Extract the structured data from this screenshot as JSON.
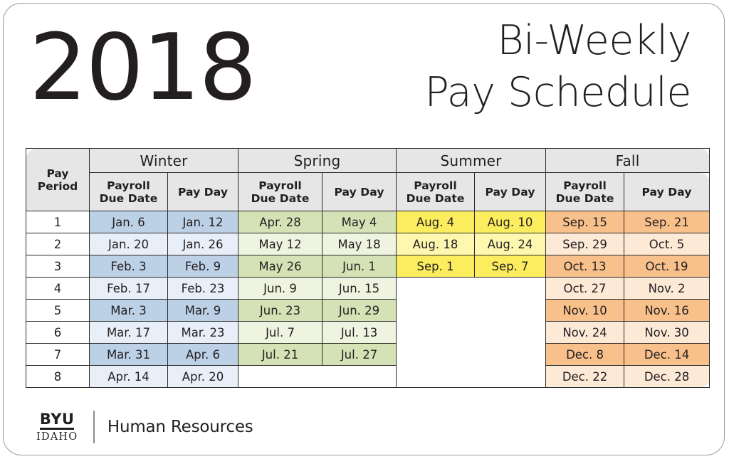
{
  "document": {
    "year": "2018",
    "headline_line1": "Bi-Weekly",
    "headline_line2": "Pay Schedule"
  },
  "table": {
    "pay_period_header": "Pay\nPeriod",
    "pay_period_header_line1": "Pay",
    "pay_period_header_line2": "Period",
    "seasons": [
      "Winter",
      "Spring",
      "Summer",
      "Fall"
    ],
    "sub_headers": [
      "Payroll Due Date",
      "Pay Day"
    ],
    "sub_header_due_line1": "Payroll",
    "sub_header_due_line2": "Due Date",
    "sub_header_payday": "Pay Day",
    "pay_periods": [
      "1",
      "2",
      "3",
      "4",
      "5",
      "6",
      "7",
      "8"
    ],
    "winter": {
      "due": [
        "Jan. 6",
        "Jan. 20",
        "Feb. 3",
        "Feb. 17",
        "Mar. 3",
        "Mar. 17",
        "Mar. 31",
        "Apr. 14"
      ],
      "payday": [
        "Jan. 12",
        "Jan. 26",
        "Feb. 9",
        "Feb. 23",
        "Mar. 9",
        "Mar. 23",
        "Apr. 6",
        "Apr. 20"
      ]
    },
    "spring": {
      "due": [
        "Apr. 28",
        "May 12",
        "May 26",
        "Jun. 9",
        "Jun. 23",
        "Jul. 7",
        "Jul. 21",
        ""
      ],
      "payday": [
        "May 4",
        "May 18",
        "Jun. 1",
        "Jun. 15",
        "Jun. 29",
        "Jul. 13",
        "Jul. 27",
        ""
      ]
    },
    "summer": {
      "due": [
        "Aug. 4",
        "Aug. 18",
        "Sep. 1",
        "",
        "",
        "",
        "",
        ""
      ],
      "payday": [
        "Aug. 10",
        "Aug. 24",
        "Sep. 7",
        "",
        "",
        "",
        "",
        ""
      ]
    },
    "fall": {
      "due": [
        "Sep. 15",
        "Sep. 29",
        "Oct. 13",
        "Oct. 27",
        "Nov. 10",
        "Nov. 24",
        "Dec. 8",
        "Dec. 22"
      ],
      "payday": [
        "Sep. 21",
        "Oct. 5",
        "Oct. 19",
        "Nov. 2",
        "Nov. 16",
        "Nov. 30",
        "Dec. 14",
        "Dec. 28"
      ]
    }
  },
  "footer": {
    "logo_top": "BYU",
    "logo_bottom": "IDAHO",
    "department": "Human Resources"
  },
  "colors": {
    "header_bg": "#e6e6e6",
    "winter_dark": "#bcd0e6",
    "winter_light": "#e8eff8",
    "spring_dark": "#d4e2b6",
    "spring_light": "#eef4e0",
    "summer_dark": "#fced5e",
    "summer_light": "#fdf7af",
    "fall_dark": "#f8c08a",
    "fall_light": "#fce9d6",
    "text": "#231f20",
    "border": "#2b2b2b",
    "card_border": "#9a9a9a"
  }
}
